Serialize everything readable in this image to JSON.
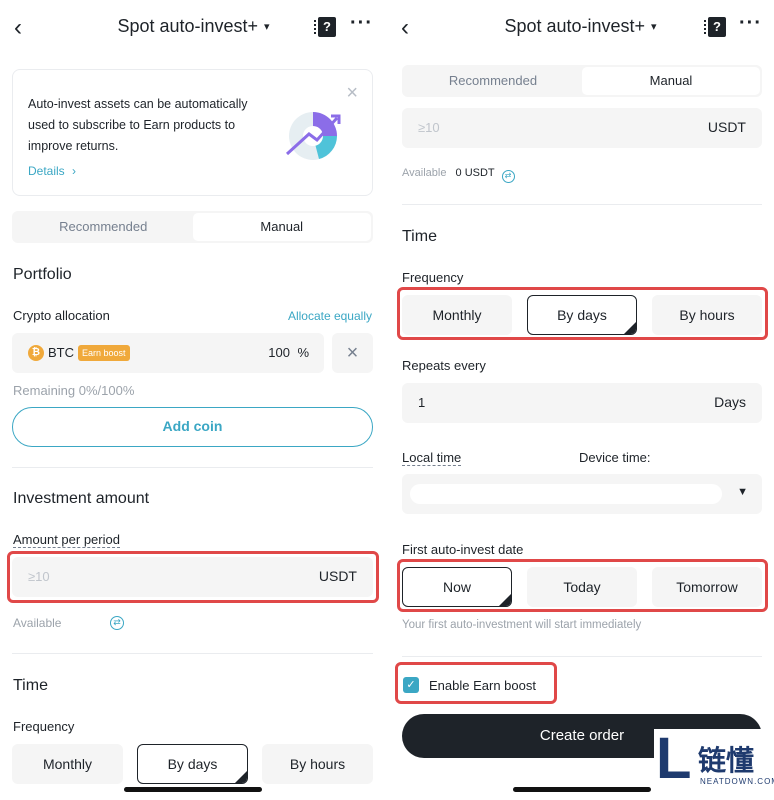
{
  "header": {
    "title": "Spot auto-invest+",
    "caret": "▾",
    "more": "···",
    "help": "?"
  },
  "banner": {
    "text": "Auto-invest assets can be automatically used to subscribe to Earn products to improve returns.",
    "details": "Details",
    "close": "×"
  },
  "tabs": {
    "recommended": "Recommended",
    "manual": "Manual",
    "active": "Manual"
  },
  "portfolio": {
    "title": "Portfolio",
    "allocation_label": "Crypto allocation",
    "allocate_equally": "Allocate equally",
    "coin": {
      "symbol": "BTC",
      "badge": "Earn boost",
      "percent": "100",
      "percent_unit": "%"
    },
    "remaining": "Remaining 0%/100%",
    "add_coin": "Add coin"
  },
  "investment": {
    "title": "Investment amount",
    "amount_label": "Amount per period",
    "placeholder": "≥10",
    "unit": "USDT",
    "available_label": "Available",
    "available_value": "0 USDT"
  },
  "time": {
    "title": "Time",
    "frequency_label": "Frequency",
    "frequency_options": [
      "Monthly",
      "By days",
      "By hours"
    ],
    "frequency_selected": "By days",
    "repeats_label": "Repeats every",
    "repeats_value": "1",
    "repeats_unit": "Days",
    "local_time": "Local time",
    "device_time": "Device time:",
    "first_date_label": "First auto-invest date",
    "first_date_options": [
      "Now",
      "Today",
      "Tomorrow"
    ],
    "first_date_selected": "Now",
    "first_date_note": "Your first auto-investment will start immediately"
  },
  "earn_boost": {
    "label": "Enable Earn boost",
    "checked": true
  },
  "create_order": "Create order",
  "watermark": {
    "cn": "链懂",
    "en": "NEATDOWN.COM",
    "letter": "L"
  },
  "colors": {
    "accent": "#3ba7c4",
    "highlight": "#e04848",
    "badge": "#f0a93b"
  }
}
